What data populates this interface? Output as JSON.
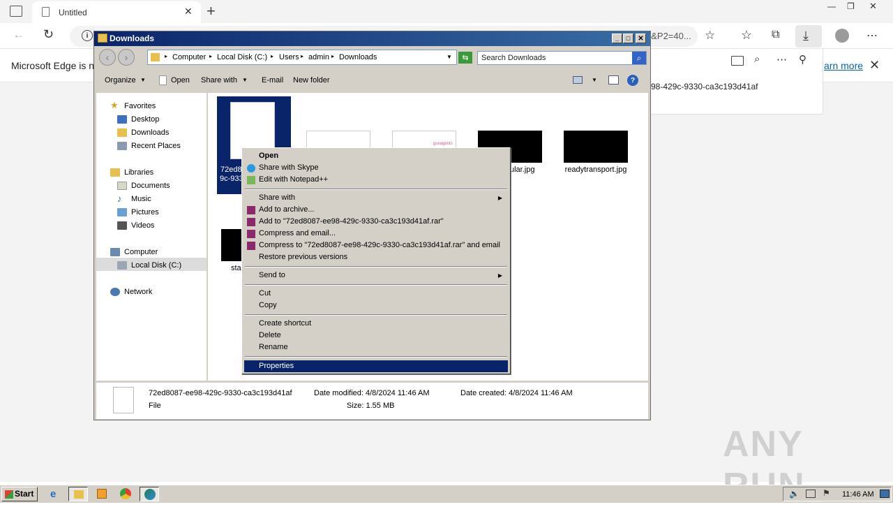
{
  "edge": {
    "tab_title": "Untitled",
    "address_tail": "8&P2=40...",
    "infobar_text": "Microsoft Edge is no",
    "learn_more": "arn more",
    "download_item": "98-429c-9330-ca3c193d41af"
  },
  "explorer": {
    "title": "Downloads",
    "breadcrumb": [
      "Computer",
      "Local Disk (C:)",
      "Users",
      "admin",
      "Downloads"
    ],
    "search_placeholder": "Search Downloads",
    "toolbar": {
      "organize": "Organize",
      "open": "Open",
      "share_with": "Share with",
      "email": "E-mail",
      "new_folder": "New folder"
    },
    "nav": {
      "favorites": "Favorites",
      "desktop": "Desktop",
      "downloads": "Downloads",
      "recent_places": "Recent Places",
      "libraries": "Libraries",
      "documents": "Documents",
      "music": "Music",
      "pictures": "Pictures",
      "videos": "Videos",
      "computer": "Computer",
      "local_disk": "Local Disk (C:)",
      "network": "Network"
    },
    "files": {
      "selected_line1": "72ed8",
      "selected_line2": "9c-933",
      "thumb3_text": "guvagents",
      "file4": "ular.jpg",
      "file5": "readytransport.jpg",
      "file6": "star"
    },
    "details": {
      "name": "72ed8087-ee98-429c-9330-ca3c193d41af",
      "type": "File",
      "date_modified": "Date modified: 4/8/2024 11:46 AM",
      "date_created": "Date created: 4/8/2024 11:46 AM",
      "size": "Size: 1.55 MB"
    }
  },
  "context_menu": {
    "open": "Open",
    "share_skype": "Share with Skype",
    "edit_notepad": "Edit with Notepad++",
    "share_with": "Share with",
    "add_archive": "Add to archive...",
    "add_rar": "Add to \"72ed8087-ee98-429c-9330-ca3c193d41af.rar\"",
    "compress_email": "Compress and email...",
    "compress_rar_email": "Compress to \"72ed8087-ee98-429c-9330-ca3c193d41af.rar\" and email",
    "restore": "Restore previous versions",
    "send_to": "Send to",
    "cut": "Cut",
    "copy": "Copy",
    "create_shortcut": "Create shortcut",
    "delete": "Delete",
    "rename": "Rename",
    "properties": "Properties"
  },
  "taskbar": {
    "start": "Start",
    "clock": "11:46 AM"
  },
  "watermark": "ANY RUN"
}
